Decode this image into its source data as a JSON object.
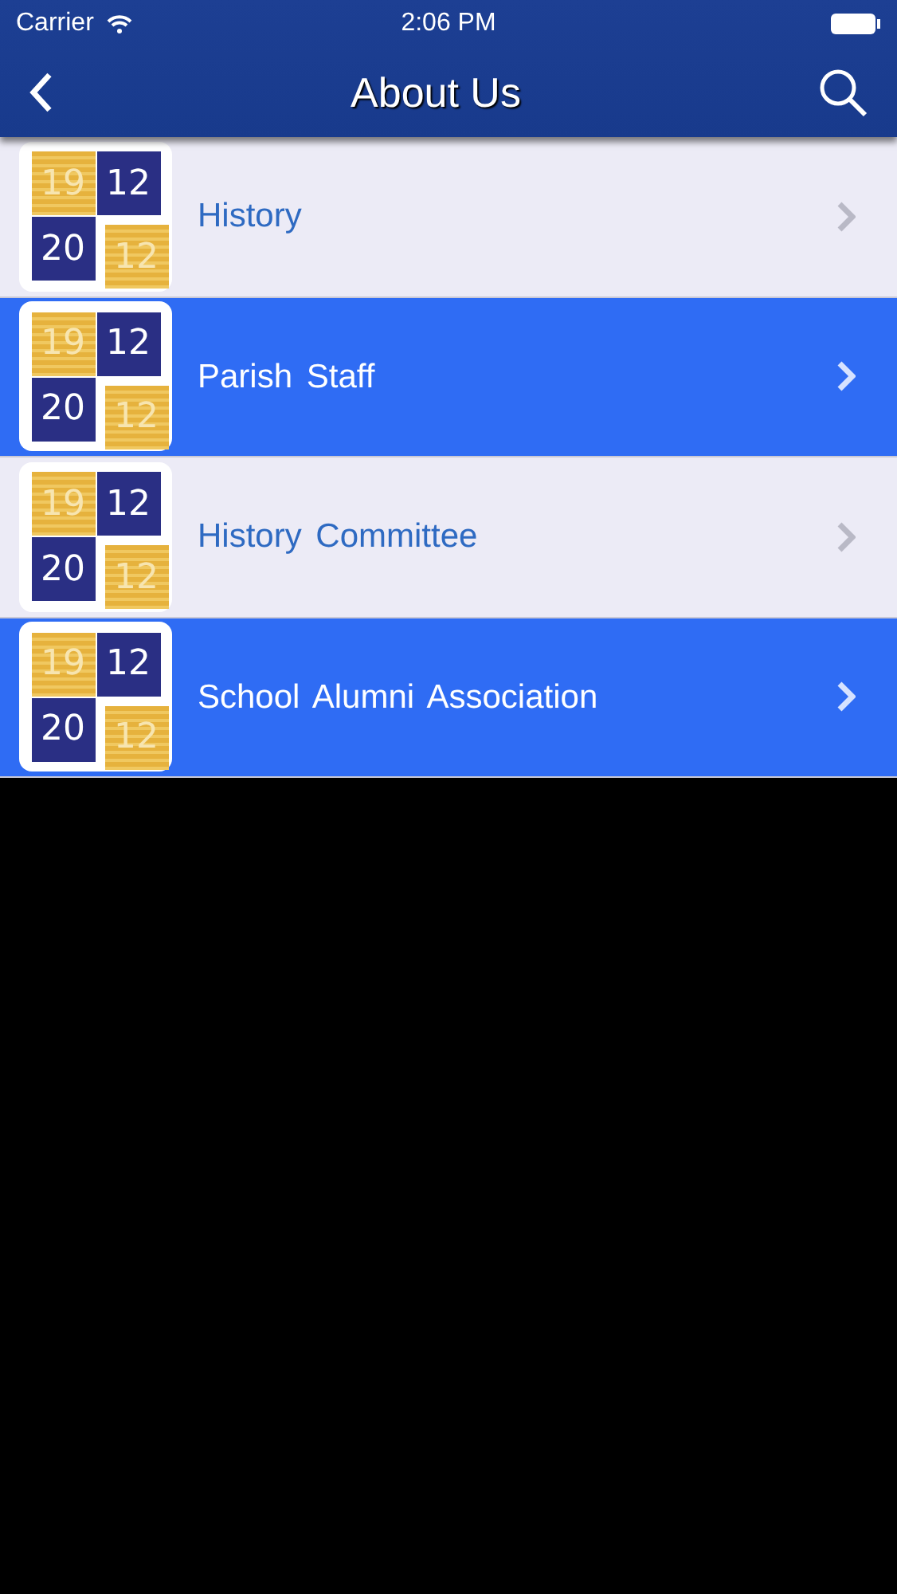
{
  "status_bar": {
    "carrier": "Carrier",
    "time": "2:06 PM"
  },
  "nav_bar": {
    "title": "About Us"
  },
  "items": [
    {
      "label": "History",
      "kind": "light",
      "logo": [
        "19",
        "12",
        "20",
        "12"
      ]
    },
    {
      "label": "Parish Staff",
      "kind": "dark",
      "logo": [
        "19",
        "12",
        "20",
        "12"
      ]
    },
    {
      "label": "History Committee",
      "kind": "light",
      "logo": [
        "19",
        "12",
        "20",
        "12"
      ]
    },
    {
      "label": "School Alumni Association",
      "kind": "dark",
      "logo": [
        "19",
        "12",
        "20",
        "12"
      ]
    }
  ]
}
